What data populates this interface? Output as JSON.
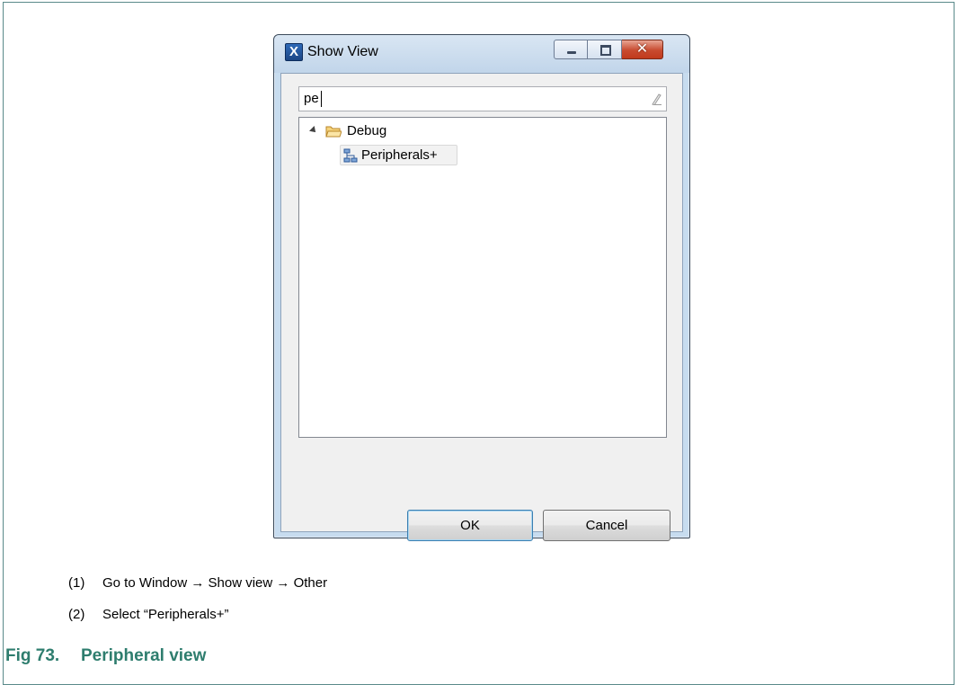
{
  "dialog": {
    "title": "Show View",
    "app_icon_letter": "X",
    "window_buttons": {
      "minimize": "minimize",
      "maximize": "maximize",
      "close": "✕"
    },
    "filter": {
      "value": "pe",
      "icon": "eraser-icon"
    },
    "tree": {
      "category": {
        "label": "Debug",
        "expanded": true,
        "icon": "folder-icon"
      },
      "item": {
        "label": "Peripherals+",
        "selected": true,
        "icon": "peripherals-view-icon"
      }
    },
    "buttons": {
      "ok": "OK",
      "cancel": "Cancel"
    }
  },
  "instructions": [
    {
      "num": "(1)",
      "text": "Go to Window → Show view → Other"
    },
    {
      "num": "(2)",
      "text": "Select “Peripherals+”"
    }
  ],
  "caption": {
    "number": "Fig 73.",
    "text": "Peripheral view"
  },
  "colors": {
    "caption": "#2e7d6e",
    "frame_border": "#5a8a8a",
    "title_bar": "#c7dcef"
  }
}
